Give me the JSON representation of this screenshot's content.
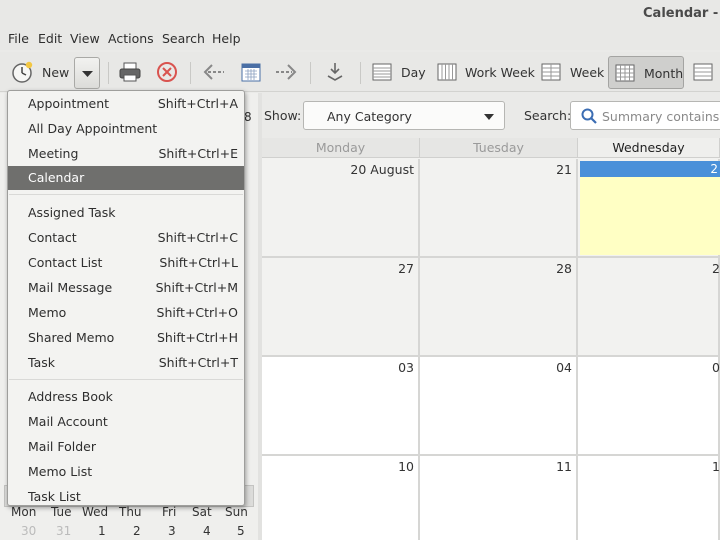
{
  "window": {
    "title": "Calendar - E"
  },
  "menubar": [
    "File",
    "Edit",
    "View",
    "Actions",
    "Search",
    "Help"
  ],
  "toolbar": {
    "new_label": "New",
    "views": [
      {
        "label": "Day"
      },
      {
        "label": "Work Week"
      },
      {
        "label": "Week"
      },
      {
        "label": "Month",
        "active": true
      }
    ]
  },
  "new_menu": {
    "groups": [
      [
        {
          "label": "Appointment",
          "accel": "Shift+Ctrl+A"
        },
        {
          "label": "All Day Appointment",
          "accel": ""
        },
        {
          "label": "Meeting",
          "accel": "Shift+Ctrl+E"
        },
        {
          "label": "Calendar",
          "accel": "",
          "highlighted": true
        }
      ],
      [
        {
          "label": "Assigned Task",
          "accel": ""
        },
        {
          "label": "Contact",
          "accel": "Shift+Ctrl+C"
        },
        {
          "label": "Contact List",
          "accel": "Shift+Ctrl+L"
        },
        {
          "label": "Mail Message",
          "accel": "Shift+Ctrl+M"
        },
        {
          "label": "Memo",
          "accel": "Shift+Ctrl+O"
        },
        {
          "label": "Shared Memo",
          "accel": "Shift+Ctrl+H"
        },
        {
          "label": "Task",
          "accel": "Shift+Ctrl+T"
        }
      ],
      [
        {
          "label": "Address Book",
          "accel": ""
        },
        {
          "label": "Mail Account",
          "accel": ""
        },
        {
          "label": "Mail Folder",
          "accel": ""
        },
        {
          "label": "Memo List",
          "accel": ""
        },
        {
          "label": "Task List",
          "accel": ""
        }
      ]
    ]
  },
  "filter": {
    "show_label": "Show:",
    "category": "Any Category",
    "search_label": "Search:",
    "search_placeholder": "Summary contains"
  },
  "mini_calendar": {
    "weekdays": [
      "Mon",
      "Tue",
      "Wed",
      "Thu",
      "Fri",
      "Sat",
      "Sun"
    ],
    "first_row": [
      {
        "d": "30",
        "dim": true
      },
      {
        "d": "31",
        "dim": true
      },
      {
        "d": "1"
      },
      {
        "d": "2"
      },
      {
        "d": "3"
      },
      {
        "d": "4"
      },
      {
        "d": "5"
      }
    ],
    "edge_number": "8"
  },
  "month_view": {
    "day_headers": [
      "Monday",
      "Tuesday",
      "Wednesday"
    ],
    "current_day": "Wednesday",
    "weeks": [
      [
        "20 August",
        "21",
        "2"
      ],
      [
        "27",
        "28",
        "2"
      ],
      [
        "03",
        "04",
        "0"
      ],
      [
        "10",
        "11",
        "1"
      ]
    ]
  },
  "colors": {
    "today_bar": "#4a90d9",
    "today_fill": "#ffffc4",
    "menu_highlight": "#6f6f6d"
  }
}
